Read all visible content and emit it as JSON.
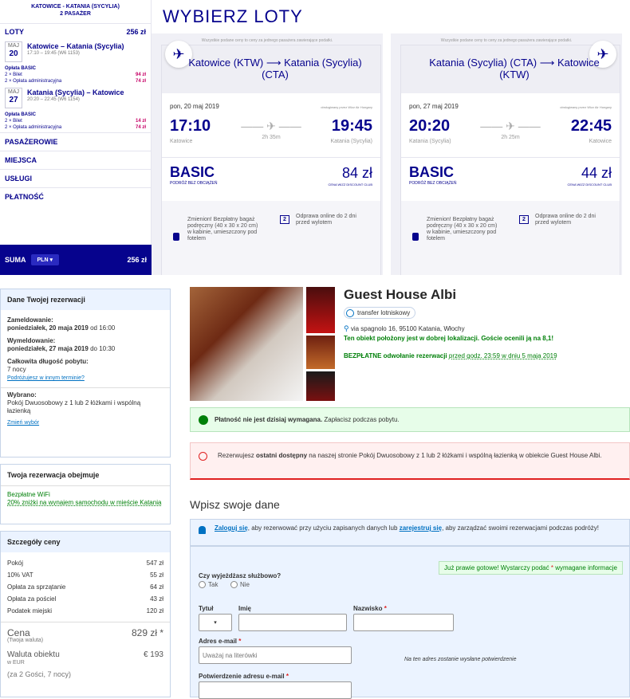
{
  "wizz": {
    "route_line1": "KATOWICE - KATANIA (SYCYLIA)",
    "route_line2": "2 PASAŻER",
    "flights_label": "LOTY",
    "flights_total": "256 zł",
    "flights": [
      {
        "month": "MAJ",
        "day": "20",
        "title": "Katowice – Katania (Sycylia)",
        "sub": "17:10 – 19:45 (W6 1153)",
        "fee_title": "Opłata BASIC",
        "fees": [
          {
            "label": "2 × Bilet",
            "value": "94 zł"
          },
          {
            "label": "2 × Opłata administracyjna",
            "value": "74 zł"
          }
        ]
      },
      {
        "month": "MAJ",
        "day": "27",
        "title": "Katania (Sycylia) – Katowice",
        "sub": "20:20 – 22:45 (W6 1154)",
        "fee_title": "Opłata BASIC",
        "fees": [
          {
            "label": "2 × Bilet",
            "value": "14 zł"
          },
          {
            "label": "2 × Opłata administracyjna",
            "value": "74 zł"
          }
        ]
      }
    ],
    "accordion": [
      "PASAŻEROWIE",
      "MIEJSCA",
      "USŁUGI",
      "PŁATNOŚĆ"
    ],
    "sum_label": "SUMA",
    "currency": "PLN",
    "sum_total": "256 zł",
    "title": "WYBIERZ LOTY",
    "note": "Wszystkie podane ceny to ceny za jednego pasażera zawierające podatki.",
    "columns": [
      {
        "route": "Katowice (KTW) ⟶ Katania (Sycylia) (CTA)",
        "date": "pon, 20 maj 2019",
        "operator": "obsługiwany przez Wizz Air Hungary",
        "dep": "17:10",
        "arr": "19:45",
        "from": "Katowice",
        "to": "Katania (Sycylia)",
        "duration": "2h 35m",
        "fare": "BASIC",
        "fare_sub": "PODRÓŻ BEZ OBCIĄŻEŃ",
        "price": "84 zł",
        "price_sub": "CENA WIZZ DISCOUNT CLUB",
        "feat1": "Zmienion! Bezpłatny bagaż podręczny (40 x 30 x 20 cm) w kabinie, umieszczony pod fotelem",
        "feat2": "Odprawa online do 2 dni przed wylotem"
      },
      {
        "route": "Katania (Sycylia) (CTA) ⟶ Katowice (KTW)",
        "date": "pon, 27 maj 2019",
        "operator": "obsługiwany przez Wizz Air Hungary",
        "dep": "20:20",
        "arr": "22:45",
        "from": "Katania (Sycylia)",
        "to": "Katowice",
        "duration": "2h 25m",
        "fare": "BASIC",
        "fare_sub": "PODRÓŻ BEZ OBCIĄŻEŃ",
        "price": "44 zł",
        "price_sub": "CENA WIZZ DISCOUNT CLUB",
        "feat1": "Zmienion! Bezpłatny bagaż podręczny (40 x 30 x 20 cm) w kabinie, umieszczony pod fotelem",
        "feat2": "Odprawa online do 2 dni przed wylotem"
      }
    ]
  },
  "booking": {
    "res_title": "Dane Twojej rezerwacji",
    "checkin_label": "Zameldowanie:",
    "checkin_date": "poniedziałek, 20 maja 2019",
    "checkin_time": "od 16:00",
    "checkout_label": "Wymeldowanie:",
    "checkout_date": "poniedziałek, 27 maja 2019",
    "checkout_time": "do 10:30",
    "length_label": "Całkowita długość pobytu:",
    "length_value": "7 nocy",
    "other_date_link": "Podróżujesz w innym terminie?",
    "chosen_label": "Wybrano:",
    "chosen_value": "Pokój Dwuosobowy z 1 lub 2 łóżkami i wspólną łazienką",
    "change_link": "Zmień wybór",
    "includes_title": "Twoja rezerwacja obejmuje",
    "includes": [
      "Bezpłatne WiFi",
      "20% zniżki na wynajem samochodu w mieście Katania"
    ],
    "price_title": "Szczegóły ceny",
    "price_rows": [
      {
        "label": "Pokój",
        "value": "547 zł"
      },
      {
        "label": "10% VAT",
        "value": "55 zł"
      },
      {
        "label": "Opłata za sprzątanie",
        "value": "64 zł"
      },
      {
        "label": "Opłata za pościel",
        "value": "43 zł"
      },
      {
        "label": "Podatek miejski",
        "value": "120 zł"
      }
    ],
    "total_label": "Cena",
    "total_sub": "(Twoja waluta)",
    "total_value": "829 zł *",
    "prop_label": "Waluta obiektu",
    "prop_sub": "w EUR",
    "prop_value": "€ 193",
    "guests_note": "(za 2 Gości, 7 nocy)",
    "hotel_name": "Guest House Albi",
    "transfer": "transfer lotniskowy",
    "address": "via spagnolo 16, 95100 Katania, Włochy",
    "location": "Ten obiekt położony jest w dobrej lokalizacji. Goście ocenili ją na 8,1!",
    "free_cancel": "BEZPŁATNE odwołanie rezerwacji",
    "cancel_until": "przed godz. 23:59 w dniu 5 maja 2019",
    "pay_bold": "Płatność nie jest dzisiaj wymagana.",
    "pay_rest": "Zapłacisz podczas pobytu.",
    "last_pre": "Rezerwujesz",
    "last_bold": "ostatni dostępny",
    "last_rest": "na naszej stronie Pokój Dwuosobowy z 1 lub 2 łóżkami i wspólną łazienką w obiekcie Guest House Albi.",
    "form_title": "Wpisz swoje dane",
    "login_link": "Zaloguj się",
    "login_mid": ", aby rezerwować przy użyciu zapisanych danych lub",
    "register_link": "zarejestruj się",
    "login_end": ", aby zarządzać swoimi rezerwacjami podczas podróży!",
    "ready_pre": "Już prawie gotowe! Wystarczy podać",
    "ready_post": "wymagane informacje",
    "business_q": "Czy wyjeżdżasz służbowo?",
    "yes": "Tak",
    "no": "Nie",
    "title_label": "Tytuł",
    "first_label": "Imię",
    "last_label": "Nazwisko",
    "title_select": "▾",
    "email_label": "Adres e-mail",
    "email_placeholder": "Uważaj na literówki",
    "email_note": "Na ten adres zostanie wysłane potwierdzenie",
    "confirm_label": "Potwierdzenie adresu e-mail"
  }
}
